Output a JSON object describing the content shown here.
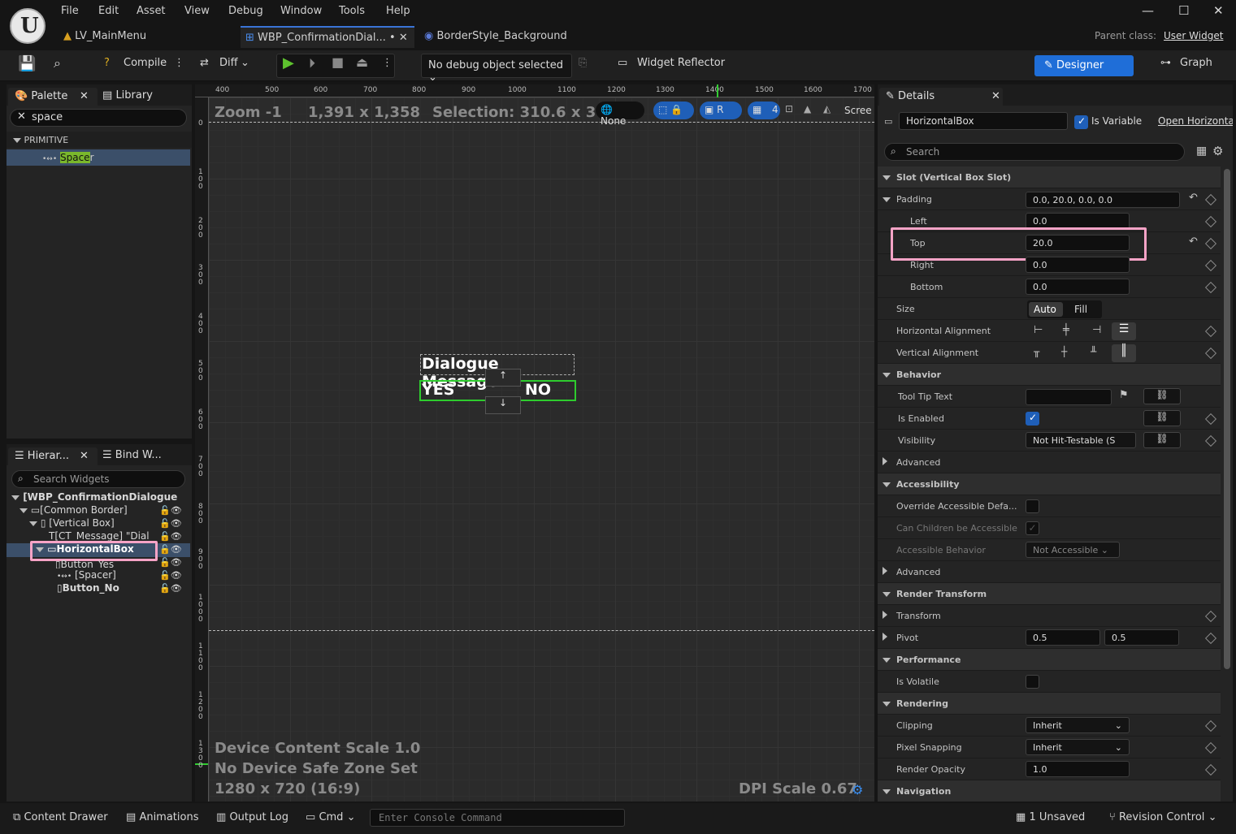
{
  "menu": [
    "File",
    "Edit",
    "Asset",
    "View",
    "Debug",
    "Window",
    "Tools",
    "Help"
  ],
  "tabs": [
    "LV_MainMenu",
    "WBP_ConfirmationDial... •",
    "BorderStyle_Background"
  ],
  "parent_class_label": "Parent class:",
  "parent_class_value": "User Widget",
  "toolbar": {
    "compile": "Compile",
    "diff": "Diff",
    "debug_object": "No debug object selected",
    "widget_reflector": "Widget Reflector",
    "designer": "Designer",
    "graph": "Graph"
  },
  "palette": {
    "tab": "Palette",
    "library_tab": "Library",
    "search_value": "space",
    "category": "PRIMITIVE",
    "item_highlight": "Space",
    "item_rest": "r"
  },
  "hierarchy": {
    "tab": "Hierar...",
    "bind_tab": "Bind W...",
    "search_placeholder": "Search Widgets",
    "rows": [
      "[WBP_ConfirmationDialogue",
      "[Common Border]",
      "[Vertical Box]",
      "[CT_Message] \"Dial",
      "HorizontalBox",
      "Button_Yes",
      "[Spacer]",
      "Button_No"
    ]
  },
  "viewport": {
    "zoom": "Zoom -1",
    "resolution": "1,391 x 1,358",
    "selection": "Selection: 310.6 x 36.04",
    "none": "None",
    "r": "R",
    "grid_num": "4",
    "screen": "Scree",
    "ruler_top": [
      "400",
      "500",
      "600",
      "700",
      "800",
      "900",
      "1000",
      "1100",
      "1200",
      "1300",
      "1400",
      "1500",
      "1600",
      "1700"
    ],
    "ruler_left": [
      "0",
      "1\n0\n0",
      "2\n0\n0",
      "3\n0\n0",
      "4\n0\n0",
      "5\n0\n0",
      "6\n0\n0",
      "7\n0\n0",
      "8\n0\n0",
      "9\n0\n0",
      "1\n0\n0\n0",
      "1\n1\n0\n0",
      "1\n2\n0\n0",
      "1\n3\n0\n0"
    ],
    "dialogue_message": "Dialogue Message",
    "yes": "YES",
    "no": "NO",
    "up": "↑",
    "down": "↓",
    "device_scale": "Device Content Scale 1.0",
    "safe_zone": "No Device Safe Zone Set",
    "device_res": "1280 x 720 (16:9)",
    "dpi": "DPI Scale 0.67"
  },
  "details": {
    "tab": "Details",
    "widget_name": "HorizontalBox",
    "is_variable": "Is Variable",
    "open": "Open Horizonta",
    "search_placeholder": "Search",
    "slot_section": "Slot (Vertical Box Slot)",
    "padding": "Padding",
    "padding_value": "0.0, 20.0, 0.0, 0.0",
    "left": "Left",
    "left_v": "0.0",
    "top": "Top",
    "top_v": "20.0",
    "right": "Right",
    "right_v": "0.0",
    "bottom": "Bottom",
    "bottom_v": "0.0",
    "size": "Size",
    "auto": "Auto",
    "fill": "Fill",
    "h_align": "Horizontal Alignment",
    "v_align": "Vertical Alignment",
    "behavior": "Behavior",
    "tooltip": "Tool Tip Text",
    "is_enabled": "Is Enabled",
    "visibility": "Visibility",
    "visibility_v": "Not Hit-Testable (S",
    "advanced": "Advanced",
    "accessibility": "Accessibility",
    "override_acc": "Override Accessible Defa...",
    "children_acc": "Can Children be Accessible",
    "acc_behavior": "Accessible Behavior",
    "acc_behavior_v": "Not Accessible",
    "advanced2": "Advanced",
    "render_transform": "Render Transform",
    "transform": "Transform",
    "pivot": "Pivot",
    "pivot_x": "0.5",
    "pivot_y": "0.5",
    "performance": "Performance",
    "is_volatile": "Is Volatile",
    "rendering": "Rendering",
    "clipping": "Clipping",
    "clipping_v": "Inherit",
    "pixel_snapping": "Pixel Snapping",
    "pixel_snapping_v": "Inherit",
    "render_opacity": "Render Opacity",
    "render_opacity_v": "1.0",
    "navigation": "Navigation"
  },
  "statusbar": {
    "content_drawer": "Content Drawer",
    "animations": "Animations",
    "output_log": "Output Log",
    "cmd": "Cmd",
    "console_placeholder": "Enter Console Command",
    "unsaved": "1 Unsaved",
    "revision": "Revision Control"
  }
}
